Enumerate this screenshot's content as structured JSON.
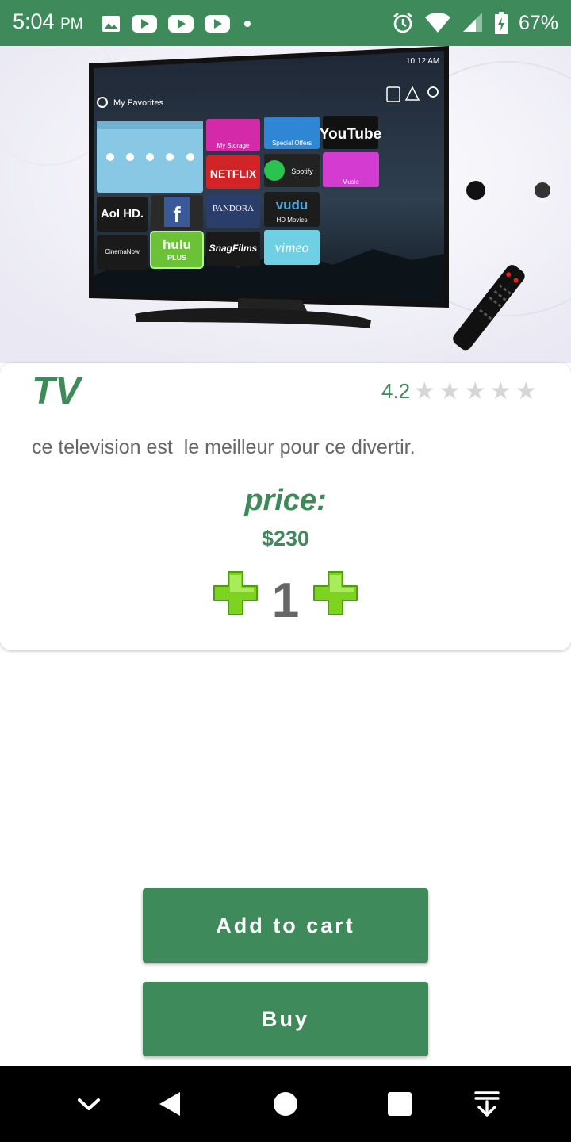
{
  "status_bar": {
    "time": "5:04",
    "ampm": "PM",
    "battery": "67%",
    "left_icons": [
      "image-icon",
      "youtube-icon",
      "youtube-icon",
      "youtube-icon",
      "dot-icon"
    ],
    "right_icons": [
      "alarm-icon",
      "wifi-icon",
      "signal-icon",
      "battery-charging-icon"
    ]
  },
  "product": {
    "title": "TV",
    "rating": "4.2",
    "rating_value": 4.2,
    "rating_max": 5,
    "description": "ce television est  le meilleur pour ce divertir.",
    "price_label": "price:",
    "price": "$230",
    "quantity": "1"
  },
  "hero": {
    "clock": "10:12 AM",
    "favorites_label": "My Favorites",
    "tiles": {
      "my_storage": "My Storage",
      "special_offers": "Special Offers",
      "youtube": "YouTube",
      "netflix": "NETFLIX",
      "spotify": "Spotify",
      "music": "Music",
      "aol": "Aol HD.",
      "pandora": "PANDORA",
      "vudu": "vudu",
      "hd_movies": "HD Movies",
      "cinemanow": "CinemaNow",
      "hulu": "hulu",
      "hulu_plus": "PLUS",
      "snagfilms": "SnagFilms",
      "vimeo": "vimeo"
    }
  },
  "actions": {
    "add_to_cart": "Add to cart",
    "buy": "Buy"
  },
  "colors": {
    "primary": "#3e8a5a",
    "plus_green": "#7ed321",
    "star_empty": "#d6d6d6"
  },
  "nav_bar": {
    "icons": [
      "chevron-down-icon",
      "back-icon",
      "home-icon",
      "recents-icon",
      "download-icon"
    ]
  }
}
